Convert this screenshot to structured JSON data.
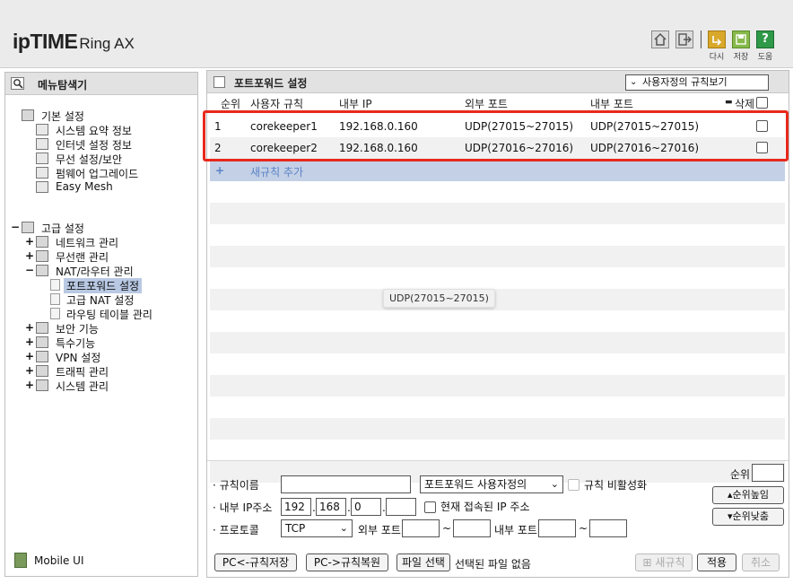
{
  "header": {
    "logo_brand": "ipTIME",
    "logo_model": "Ring AX",
    "actions": [
      {
        "icon": "home-icon"
      },
      {
        "icon": "logout-icon"
      },
      {
        "icon": "refresh-icon",
        "label": "다시",
        "color": "#d9a82b"
      },
      {
        "icon": "save-icon",
        "label": "저장",
        "color": "#86b94a"
      },
      {
        "icon": "help-icon",
        "label": "도움",
        "color": "#2e9948"
      }
    ]
  },
  "sidebar": {
    "title": "메뉴탐색기",
    "mobile_ui": "Mobile UI",
    "basic": {
      "label": "기본 설정",
      "items": [
        "시스템 요약 정보",
        "인터넷 설정 정보",
        "무선 설정/보안",
        "펌웨어 업그레이드",
        "Easy Mesh"
      ]
    },
    "advanced": {
      "toggle": "−",
      "label": "고급 설정",
      "items": [
        {
          "toggle": "+",
          "label": "네트워크 관리"
        },
        {
          "toggle": "+",
          "label": "무선랜 관리"
        },
        {
          "toggle": "−",
          "label": "NAT/라우터 관리"
        },
        {
          "label": "포트포워드 설정",
          "selected": true
        },
        {
          "label": "고급 NAT 설정"
        },
        {
          "label": "라우팅 테이블 관리"
        },
        {
          "toggle": "+",
          "label": "보안 기능"
        },
        {
          "toggle": "+",
          "label": "특수기능"
        },
        {
          "toggle": "+",
          "label": "VPN 설정"
        },
        {
          "toggle": "+",
          "label": "트래픽 관리"
        },
        {
          "toggle": "+",
          "label": "시스템 관리"
        }
      ]
    }
  },
  "main": {
    "title": "포트포워드 설정",
    "view_select": "사용자정의 규칙보기",
    "columns": {
      "rank": "순위",
      "rule_name": "사용자 규칙",
      "internal_ip": "내부 IP",
      "external_port": "외부 포트",
      "internal_port": "내부 포트",
      "delete": "삭제"
    },
    "rules": [
      {
        "rank": "1",
        "name": "corekeeper1",
        "ip": "192.168.0.160",
        "ext": "UDP(27015~27015)",
        "int": "UDP(27015~27015)"
      },
      {
        "rank": "2",
        "name": "corekeeper2",
        "ip": "192.168.0.160",
        "ext": "UDP(27016~27016)",
        "int": "UDP(27016~27016)"
      }
    ],
    "add_rule": "새규칙 추가",
    "tooltip": "UDP(27015~27015)",
    "highlight_color": "#e8291c"
  },
  "form": {
    "rule_name_label": "규칙이름",
    "rule_name_value": "",
    "preset_select": "포트포워드 사용자정의",
    "disable_rule_label": "규칙 비활성화",
    "internal_ip_label": "내부 IP주소",
    "ip_octets": [
      "192",
      "168",
      "0",
      ""
    ],
    "current_ip_label": "현재 접속된 IP 주소",
    "protocol_label": "프로토콜",
    "protocol_value": "TCP",
    "ext_port_label": "외부 포트",
    "int_port_label": "내부 포트",
    "tilde": "~",
    "rank_label": "순위",
    "rank_up": "순위높임",
    "rank_down": "순위낮춤",
    "backup_button": "PC<-규칙저장",
    "restore_button": "PC->규칙복원",
    "file_button": "파일 선택",
    "file_status": "선택된 파일 없음",
    "new_rule_button": "새규칙",
    "apply_button": "적용",
    "cancel_button": "취소"
  }
}
